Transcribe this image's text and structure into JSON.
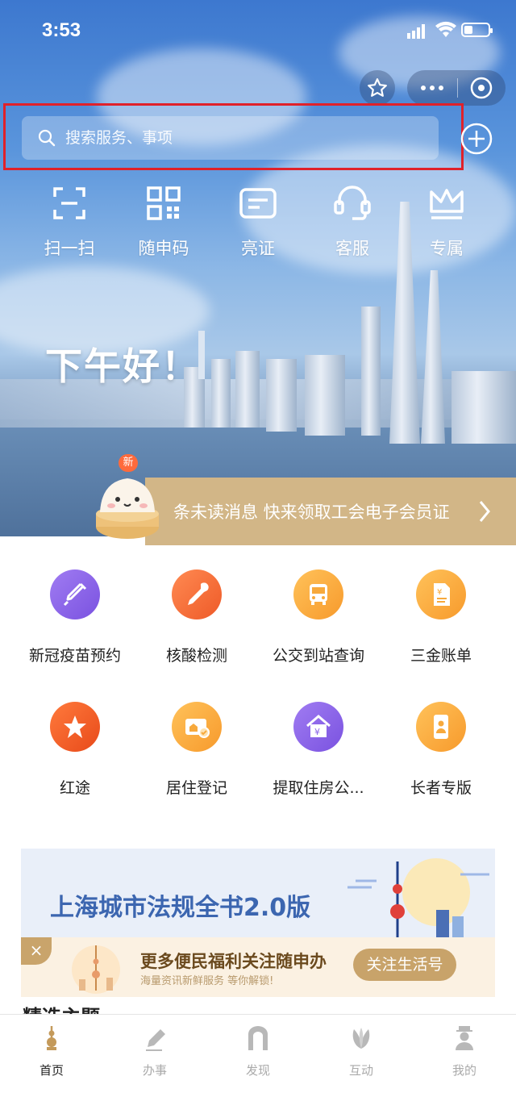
{
  "status_bar": {
    "time": "3:53"
  },
  "search": {
    "placeholder": "搜索服务、事项"
  },
  "quick_actions": [
    {
      "label": "扫一扫",
      "icon": "scan-icon"
    },
    {
      "label": "随申码",
      "icon": "qr-code-icon"
    },
    {
      "label": "亮证",
      "icon": "id-card-icon"
    },
    {
      "label": "客服",
      "icon": "headset-icon"
    },
    {
      "label": "专属",
      "icon": "crown-icon"
    }
  ],
  "greeting": "下午好！",
  "notice": {
    "badge": "新",
    "text": "条未读消息 快来领取工会电子会员证"
  },
  "services": [
    {
      "label": "新冠疫苗预约",
      "icon": "syringe-icon",
      "color": "#8a63e8"
    },
    {
      "label": "核酸检测",
      "icon": "pipette-icon",
      "color": "#f2683a"
    },
    {
      "label": "公交到站查询",
      "icon": "bus-icon",
      "color": "#f7a93c"
    },
    {
      "label": "三金账单",
      "icon": "bill-icon",
      "color": "#f7a93c"
    },
    {
      "label": "红途",
      "icon": "red-star-icon",
      "color": "#f05a25"
    },
    {
      "label": "居住登记",
      "icon": "residence-card-icon",
      "color": "#f7a93c"
    },
    {
      "label": "提取住房公...",
      "icon": "house-fund-icon",
      "color": "#8a63e8"
    },
    {
      "label": "长者专版",
      "icon": "elderly-phone-icon",
      "color": "#f7a93c"
    }
  ],
  "banner": {
    "title": "上海城市法规全书2.0版",
    "follow_title": "更多便民福利关注随申办",
    "follow_subtitle": "海量资讯新鲜服务 等你解锁!",
    "follow_button": "关注生活号",
    "close": "×"
  },
  "section_title": "精选主题",
  "tabs": [
    {
      "label": "首页",
      "icon": "home-tower-icon",
      "active": true
    },
    {
      "label": "办事",
      "icon": "pen-icon",
      "active": false
    },
    {
      "label": "发现",
      "icon": "gate-icon",
      "active": false
    },
    {
      "label": "互动",
      "icon": "magnolia-icon",
      "active": false
    },
    {
      "label": "我的",
      "icon": "person-icon",
      "active": false
    }
  ]
}
